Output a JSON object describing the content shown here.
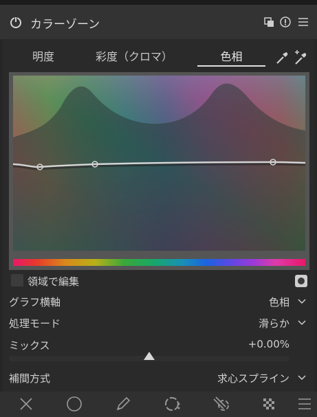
{
  "header": {
    "title": "カラーゾーン"
  },
  "tabs": [
    {
      "label": "明度"
    },
    {
      "label": "彩度（クロマ）"
    },
    {
      "label": "色相"
    }
  ],
  "controls": {
    "edit_by_area_label": "領域で編集",
    "graph_axis": {
      "label": "グラフ横軸",
      "value": "色相"
    },
    "process_mode": {
      "label": "処理モード",
      "value": "滑らか"
    },
    "mix": {
      "label": "ミックス",
      "value": "+0.00%",
      "level_fraction": 0.5
    },
    "interpolation": {
      "label": "補間方式",
      "value": "求心スプライン"
    }
  },
  "icons": {
    "power": "power-icon",
    "duplicate": "copy-icon",
    "reset": "reset-icon",
    "menu": "hamburger-menu-icon",
    "picker_single": "color-picker-icon",
    "picker_add": "color-picker-add-icon",
    "tools": [
      "close-icon",
      "circle-icon",
      "pencil-icon",
      "gradient-icon",
      "drawn-gradient-icon",
      "checker-icon",
      "menu-icon"
    ]
  },
  "colors": {
    "accent_underline": "#e0e0e0",
    "panel_bg": "#2a2a2a",
    "header_bg": "#333333"
  }
}
